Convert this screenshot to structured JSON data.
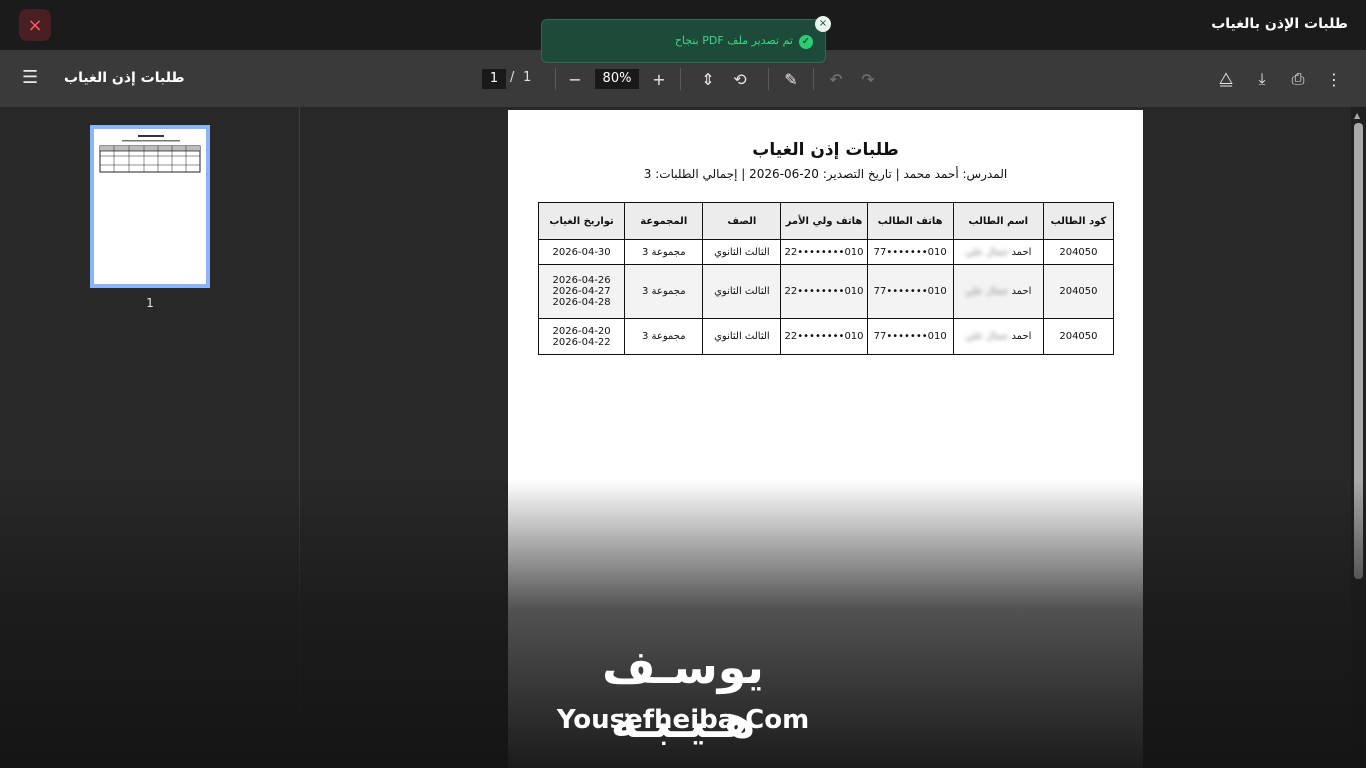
{
  "app": {
    "title": "طلبات الإذن بالغياب",
    "close_label": "×"
  },
  "toast": {
    "message": "تم تصدير ملف PDF بنجاح",
    "check": "✓",
    "close": "×"
  },
  "toolbar": {
    "menu_icon": "☰",
    "doc_title": "طلبات إذن الغياب",
    "current_page": "1",
    "separator": "/",
    "total_pages": "1",
    "zoom_out": "−",
    "zoom": "80%",
    "zoom_in": "+",
    "fit_icon": "⇕",
    "rotate_icon": "⟲",
    "annotate_icon": "✎",
    "undo_icon": "↶",
    "redo_icon": "↷",
    "drive_icon": "⧋",
    "download_icon": "⤓",
    "print_icon": "⎙",
    "more_icon": "⋮"
  },
  "sidebar": {
    "thumb_label": "1"
  },
  "document": {
    "heading": "طلبات إذن الغياب",
    "meta": "المدرس: أحمد محمد   |   تاريخ التصدير: 20-06-2026   |   إجمالي الطلبات: 3",
    "columns": [
      "كود الطالب",
      "اسم الطالب",
      "هاتف الطالب",
      "هاتف ولي الأمر",
      "الصف",
      "المجموعة",
      "تواريخ الغياب"
    ],
    "rows": [
      {
        "code": "204050",
        "name": "احمد",
        "name_blur": "جمال علي",
        "student_phone": "010•••••••77",
        "parent_phone": "010••••••••22",
        "grade": "الثالث الثانوي",
        "group": "مجموعة 3",
        "dates": [
          "2026-04-30"
        ]
      },
      {
        "code": "204050",
        "name": "احمد",
        "name_blur": "جمال علي",
        "student_phone": "010•••••••77",
        "parent_phone": "010••••••••22",
        "grade": "الثالث الثانوي",
        "group": "مجموعة 3",
        "dates": [
          "2026-04-26",
          "2026-04-27",
          "2026-04-28"
        ]
      },
      {
        "code": "204050",
        "name": "احمد",
        "name_blur": "جمال علي",
        "student_phone": "010•••••••77",
        "parent_phone": "010••••••••22",
        "grade": "الثالث الثانوي",
        "group": "مجموعة 3",
        "dates": [
          "2026-04-20",
          "2026-04-22"
        ]
      }
    ]
  },
  "watermark": {
    "arabic": "يوسـف هـيـبـة",
    "latin": "Yousefheiba.Com"
  }
}
